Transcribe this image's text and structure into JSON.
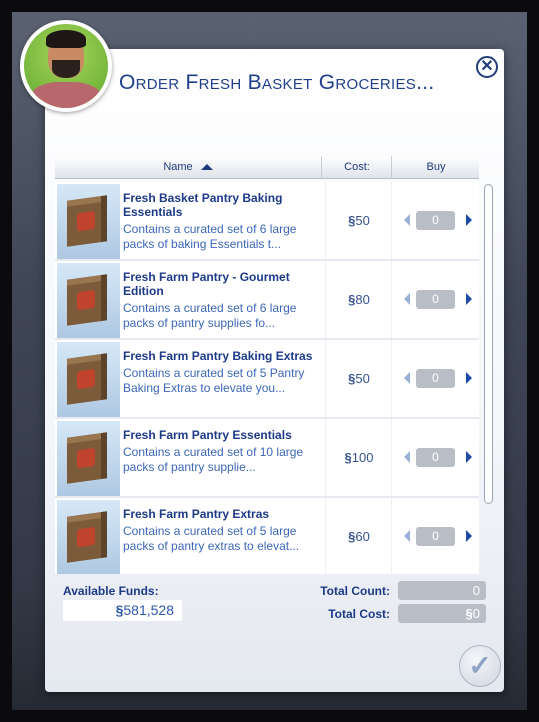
{
  "dialog": {
    "title": "Order Fresh Basket Groceries..."
  },
  "table": {
    "headers": {
      "name": "Name",
      "cost": "Cost:",
      "buy": "Buy"
    }
  },
  "items": [
    {
      "name": "Fresh Basket Pantry Baking Essentials",
      "description": "Contains a curated set of 6 large packs of baking Essentials t...",
      "cost": "50",
      "qty": "0"
    },
    {
      "name": "Fresh Farm Pantry - Gourmet Edition",
      "description": "Contains a curated set of 6 large packs of pantry supplies  fo...",
      "cost": "80",
      "qty": "0"
    },
    {
      "name": "Fresh Farm Pantry Baking Extras",
      "description": "Contains a curated set of 5 Pantry Baking Extras to elevate you...",
      "cost": "50",
      "qty": "0"
    },
    {
      "name": "Fresh Farm Pantry Essentials",
      "description": "Contains a curated set of 10 large packs of pantry supplie...",
      "cost": "100",
      "qty": "0"
    },
    {
      "name": "Fresh Farm Pantry Extras",
      "description": "Contains a curated set of 5 large packs of pantry extras to elevat...",
      "cost": "60",
      "qty": "0"
    }
  ],
  "footer": {
    "available_funds_label": "Available Funds:",
    "available_funds": "581,528",
    "total_count_label": "Total Count:",
    "total_count": "0",
    "total_cost_label": "Total Cost:",
    "total_cost": "0"
  },
  "currency_symbol": "§",
  "colors": {
    "accent": "#1c3a88",
    "link": "#3b67b8"
  }
}
